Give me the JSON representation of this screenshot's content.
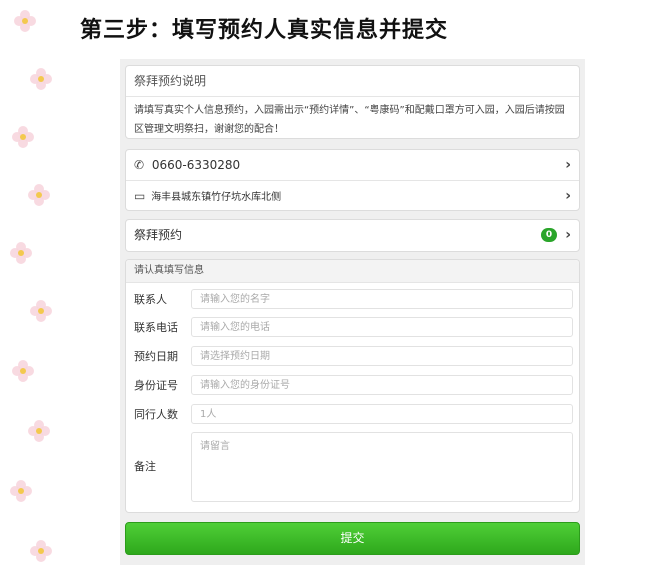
{
  "page": {
    "step_title": "第三步：填写预约人真实信息并提交"
  },
  "notice": {
    "title": "祭拜预约说明",
    "body": "请填写真实个人信息预约，入园需出示“预约详情”、“粤康码”和配戴口罩方可入园，入园后请按园区管理文明祭扫，谢谢您的配合！"
  },
  "contact": {
    "phone": "0660-6330280",
    "address": "海丰县城东镇竹仔坑水库北侧"
  },
  "booking": {
    "label": "祭拜预约",
    "count": "0"
  },
  "form": {
    "section_title": "请认真填写信息",
    "fields": [
      {
        "label": "联系人",
        "placeholder": "请输入您的名字"
      },
      {
        "label": "联系电话",
        "placeholder": "请输入您的电话"
      },
      {
        "label": "预约日期",
        "placeholder": "请选择预约日期"
      },
      {
        "label": "身份证号",
        "placeholder": "请输入您的身份证号"
      },
      {
        "label": "同行人数",
        "placeholder": "1人"
      }
    ],
    "remark": {
      "label": "备注",
      "placeholder": "请留言"
    },
    "submit_label": "提交"
  },
  "icons": {
    "phone": "phone-icon",
    "map": "map-icon",
    "chevron": "chevron-right-icon",
    "flower": "flower-decoration-icon"
  },
  "colors": {
    "accent_green": "#2ea81c",
    "badge_green": "#2aa52a"
  }
}
